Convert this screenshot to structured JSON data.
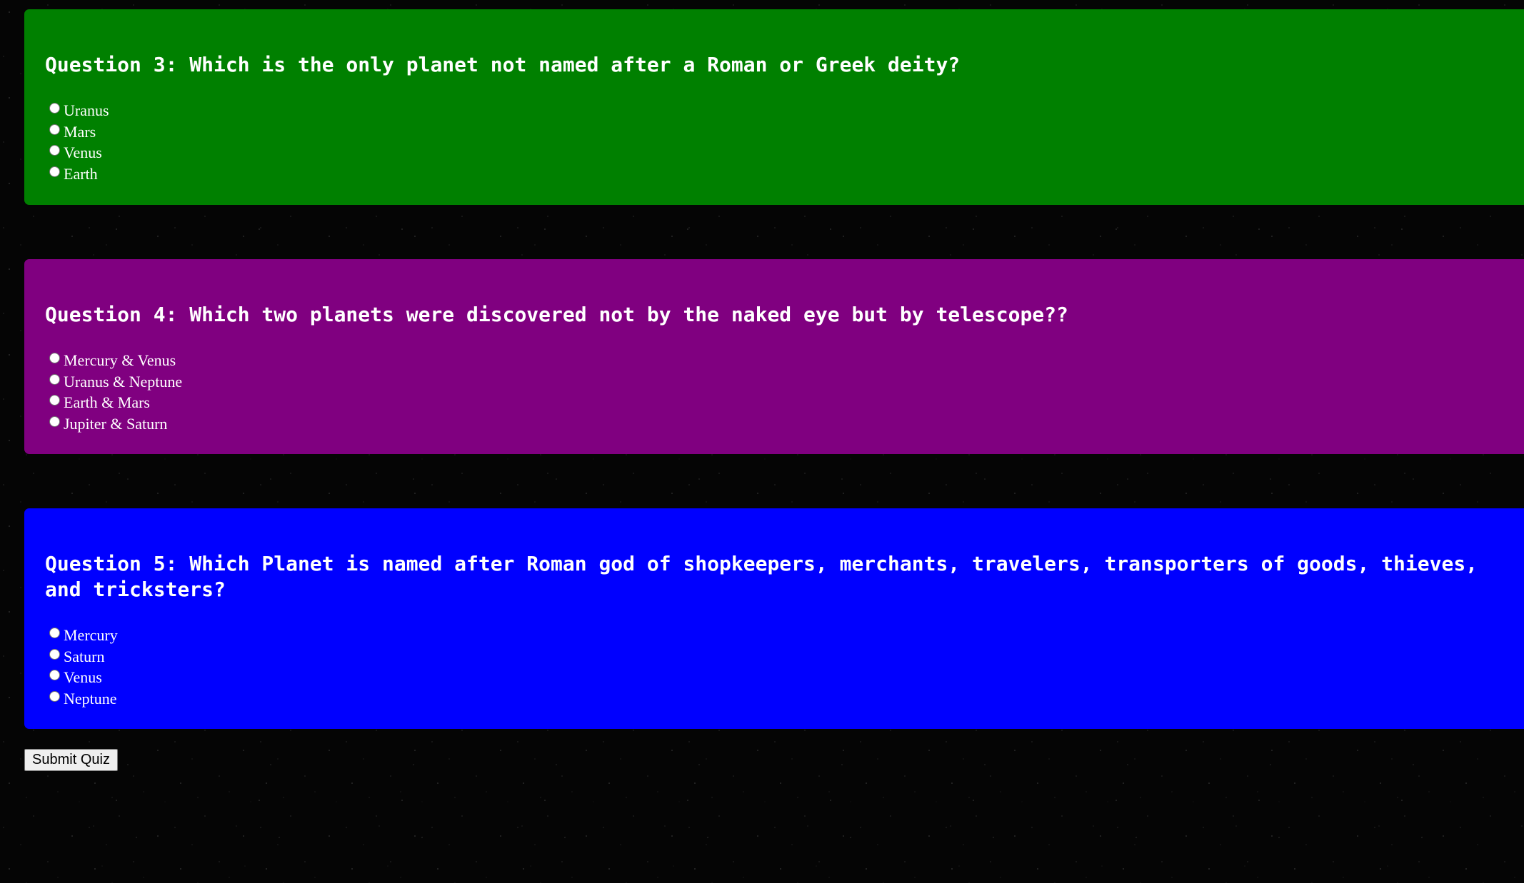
{
  "questions": [
    {
      "id": "q3",
      "color": "#008000",
      "title": "Question 3: Which is the only planet not named after a Roman or Greek deity?",
      "options": [
        "Uranus",
        "Mars",
        "Venus",
        "Earth"
      ]
    },
    {
      "id": "q4",
      "color": "#800080",
      "title": "Question 4: Which two planets were discovered not by the naked eye but by telescope??",
      "options": [
        "Mercury & Venus",
        "Uranus & Neptune",
        "Earth & Mars",
        "Jupiter & Saturn"
      ]
    },
    {
      "id": "q5",
      "color": "#0000ff",
      "title": "Question 5: Which Planet is named after Roman god of shopkeepers, merchants, travelers, transporters of goods, thieves, and tricksters?",
      "options": [
        "Mercury",
        "Saturn",
        "Venus",
        "Neptune"
      ]
    }
  ],
  "submit_label": "Submit Quiz",
  "icons": {
    "radio": "radio-button-icon"
  }
}
